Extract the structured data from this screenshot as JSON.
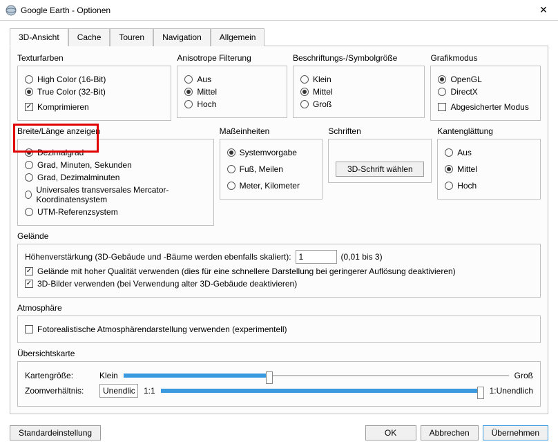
{
  "window": {
    "title": "Google Earth - Optionen"
  },
  "tabs": {
    "t0": "3D-Ansicht",
    "t1": "Cache",
    "t2": "Touren",
    "t3": "Navigation",
    "t4": "Allgemein"
  },
  "texture": {
    "label": "Texturfarben",
    "high": "High Color (16-Bit)",
    "true": "True Color (32-Bit)",
    "compress": "Komprimieren"
  },
  "aniso": {
    "label": "Anisotrope Filterung",
    "off": "Aus",
    "mid": "Mittel",
    "high": "Hoch"
  },
  "labelsize": {
    "label": "Beschriftungs-/Symbolgröße",
    "small": "Klein",
    "mid": "Mittel",
    "big": "Groß"
  },
  "gfx": {
    "label": "Grafikmodus",
    "opengl": "OpenGL",
    "directx": "DirectX",
    "safe": "Abgesicherter Modus"
  },
  "latlon": {
    "label": "Breite/Länge anzeigen",
    "dec": "Dezimalgrad",
    "dms": "Grad, Minuten, Sekunden",
    "ddm": "Grad, Dezimalminuten",
    "utm": "Universales transversales Mercator-Koordinatensystem",
    "utmref": "UTM-Referenzsystem"
  },
  "units": {
    "label": "Maßeinheiten",
    "sys": "Systemvorgabe",
    "imp": "Fuß, Meilen",
    "met": "Meter, Kilometer"
  },
  "fonts": {
    "label": "Schriften",
    "btn": "3D-Schrift wählen"
  },
  "aa": {
    "label": "Kantenglättung",
    "off": "Aus",
    "mid": "Mittel",
    "high": "Hoch"
  },
  "terrain": {
    "label": "Gelände",
    "exagLabel": "Höhenverstärkung (3D-Gebäude und -Bäume werden ebenfalls skaliert):",
    "exagVal": "1",
    "exagHint": "(0,01 bis 3)",
    "hq": "Gelände mit hoher Qualität verwenden (dies für eine schnellere Darstellung bei geringerer Auflösung deaktivieren)",
    "img3d": "3D-Bilder verwenden (bei Verwendung alter 3D-Gebäude deaktivieren)"
  },
  "atmos": {
    "label": "Atmosphäre",
    "photo": "Fotorealistische Atmosphärendarstellung verwenden (experimentell)"
  },
  "overview": {
    "label": "Übersichtskarte",
    "sizeLabel": "Kartengröße:",
    "sizeMin": "Klein",
    "sizeMax": "Groß",
    "zoomLabel": "Zoomverhältnis:",
    "zoomVal": "Unendlich",
    "zoomMin": "1:1",
    "zoomMax": "1:Unendlich"
  },
  "footer": {
    "defaults": "Standardeinstellung",
    "ok": "OK",
    "cancel": "Abbrechen",
    "apply": "Übernehmen"
  }
}
